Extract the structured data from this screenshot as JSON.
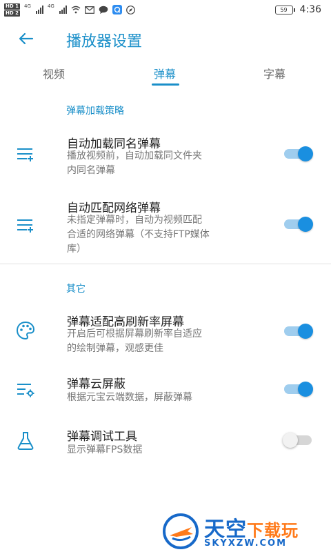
{
  "status_bar": {
    "sim1": "HD 1",
    "sim2": "HD 2",
    "net1": "4G",
    "net2": "4G",
    "battery": "59",
    "time": "4:36"
  },
  "header": {
    "title": "播放器设置"
  },
  "tabs": [
    {
      "label": "视频",
      "active": false
    },
    {
      "label": "弹幕",
      "active": true
    },
    {
      "label": "字幕",
      "active": false
    }
  ],
  "sections": [
    {
      "title": "弹幕加载策略",
      "items": [
        {
          "title": "自动加载同名弹幕",
          "desc_lines": [
            "播放视频前，自动加载同文件夹",
            "内同名弹幕"
          ],
          "icon": "playlist-add-icon",
          "enabled": true
        },
        {
          "title": "自动匹配网络弹幕",
          "desc_lines": [
            "未指定弹幕时，自动为视频匹配",
            "合适的网络弹幕（不支持FTP媒体",
            "库）"
          ],
          "icon": "playlist-add-icon",
          "enabled": true
        }
      ]
    },
    {
      "title": "其它",
      "items": [
        {
          "title": "弹幕适配高刷新率屏幕",
          "desc_lines": [
            "开启后可根据屏幕刷新率自适应",
            "的绘制弹幕，观感更佳"
          ],
          "icon": "palette-icon",
          "enabled": true
        },
        {
          "title": "弹幕云屏蔽",
          "desc_lines": [
            "根据元宝云端数据，屏蔽弹幕"
          ],
          "icon": "list-settings-icon",
          "enabled": true
        },
        {
          "title": "弹幕调试工具",
          "desc_lines": [
            "显示弹幕FPS数据"
          ],
          "icon": "flask-icon",
          "enabled": false
        }
      ]
    }
  ],
  "watermark": {
    "main_a": "天空",
    "main_b": "下载玩",
    "sub": "SKYXZW.COM"
  },
  "colors": {
    "accent": "#1a8fc9",
    "toggle_on": "#1a8fe0",
    "toggle_track_on": "#9fcdee"
  }
}
